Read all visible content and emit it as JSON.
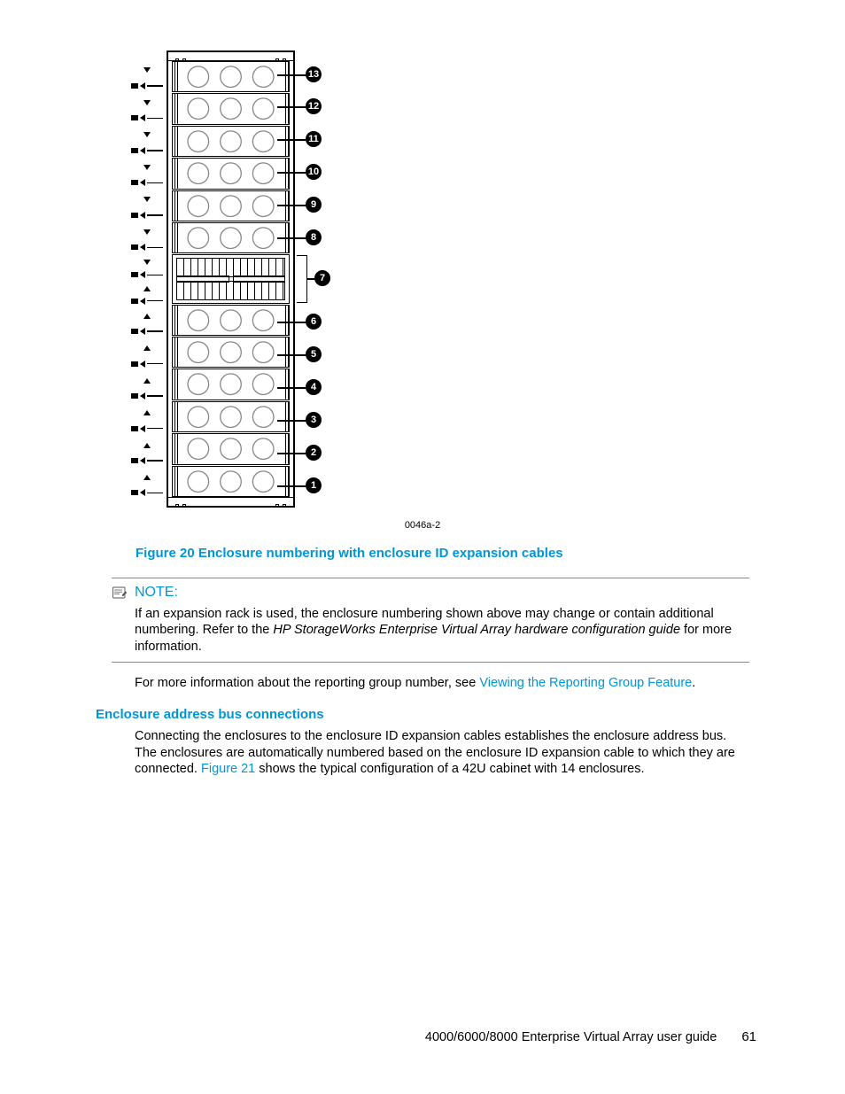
{
  "diagram": {
    "code": "0046a-2",
    "callouts": [
      "13",
      "12",
      "11",
      "10",
      "9",
      "8",
      "7",
      "6",
      "5",
      "4",
      "3",
      "2",
      "1"
    ]
  },
  "figure_caption": "Figure 20 Enclosure numbering with enclosure ID expansion cables",
  "note": {
    "label": "NOTE:",
    "body_before": "If an expansion rack is used, the enclosure numbering shown above may change or contain additional numbering. Refer to the ",
    "body_em": "HP StorageWorks Enterprise Virtual Array hardware configuration guide",
    "body_after": " for more information."
  },
  "para1_before": "For more information about the reporting group number, see ",
  "para1_link": "Viewing the Reporting Group Feature",
  "para1_after": ".",
  "subheading": "Enclosure address bus connections",
  "para2_before": "Connecting the enclosures to the enclosure ID expansion cables establishes the enclosure address bus. The enclosures are automatically numbered based on the enclosure ID expansion cable to which they are connected. ",
  "para2_link": "Figure 21",
  "para2_after": " shows the typical configuration of a 42U cabinet with 14 enclosures.",
  "footer": {
    "title": "4000/6000/8000 Enterprise Virtual Array user guide",
    "page": "61"
  }
}
